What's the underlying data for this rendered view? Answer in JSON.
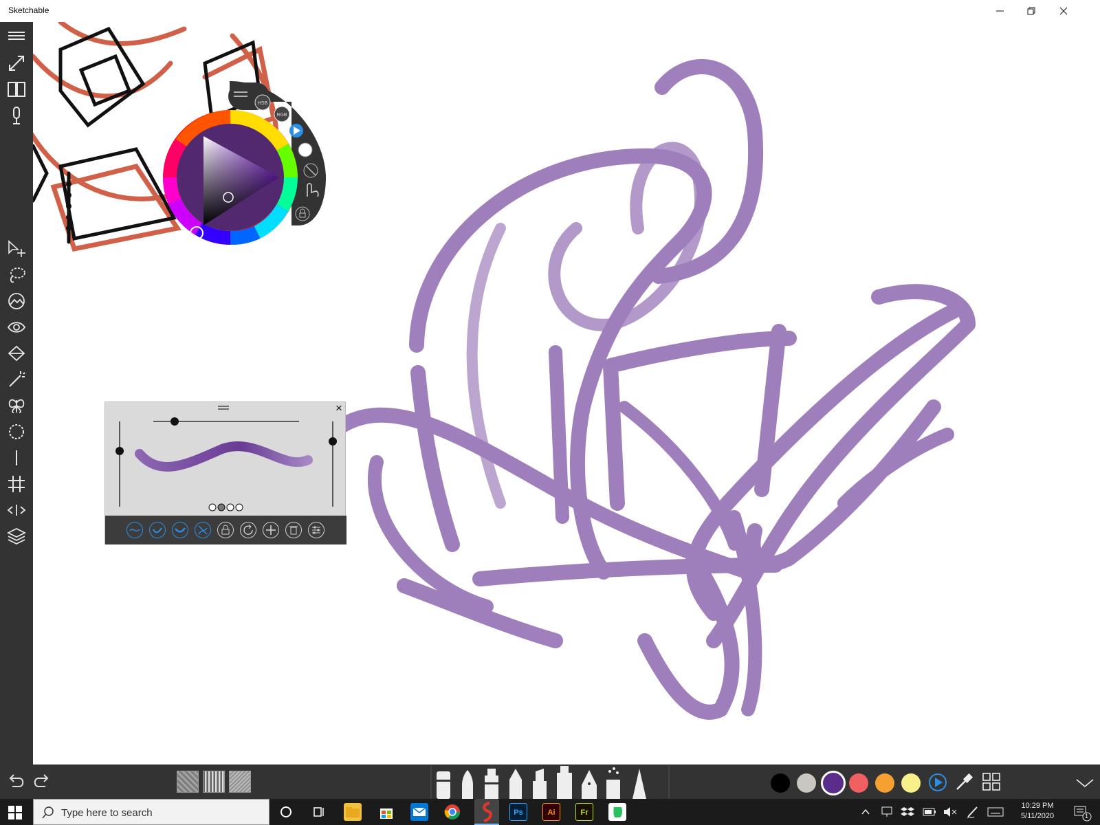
{
  "window": {
    "title": "Sketchable",
    "minimize_icon": "minimize-icon",
    "maximize_icon": "restore-icon",
    "close_icon": "close-icon"
  },
  "left_toolbar": {
    "items": [
      {
        "name": "menu-icon"
      },
      {
        "name": "fullscreen-icon"
      },
      {
        "name": "journal-icon"
      },
      {
        "name": "microphone-icon"
      },
      {
        "name": "select-move-icon"
      },
      {
        "name": "lasso-icon"
      },
      {
        "name": "image-icon"
      },
      {
        "name": "eye-icon"
      },
      {
        "name": "fill-bucket-icon"
      },
      {
        "name": "magic-wand-icon"
      },
      {
        "name": "symmetry-butterfly-icon"
      },
      {
        "name": "circle-guide-icon"
      },
      {
        "name": "line-guide-icon"
      },
      {
        "name": "grid-icon"
      },
      {
        "name": "perspective-icon"
      },
      {
        "name": "layers-icon"
      }
    ]
  },
  "color_picker": {
    "mode_hsb": "HSB",
    "mode_rgb": "RGB",
    "current_color": "#5b2d8a",
    "hue_ring": true
  },
  "brush_panel": {
    "close_label": "×",
    "preset_dots": 4,
    "active_dot": 2,
    "stroke_color": "#7a4fa3",
    "footer_buttons": [
      {
        "name": "smooth-stroke-icon",
        "active": true
      },
      {
        "name": "pressure-icon",
        "active": true
      },
      {
        "name": "taper-icon",
        "active": true
      },
      {
        "name": "jitter-icon",
        "active": true
      },
      {
        "name": "lock-icon",
        "active": false
      },
      {
        "name": "reset-icon",
        "active": false
      },
      {
        "name": "add-icon",
        "active": false
      },
      {
        "name": "delete-icon",
        "active": false
      },
      {
        "name": "settings-icon",
        "active": false
      }
    ]
  },
  "bottom_bar": {
    "undo_icon": "undo-icon",
    "redo_icon": "redo-icon",
    "textures": [
      "texture-1",
      "texture-2",
      "texture-3"
    ],
    "brushes": [
      "eraser",
      "brush",
      "marker",
      "pencil",
      "highlighter",
      "flat-marker",
      "fountain-pen",
      "airbrush",
      "smudge"
    ],
    "swatches": [
      "#000000",
      "#c8c8c0",
      "#5b2d8a",
      "#f06060",
      "#f5a030",
      "#f8f08a"
    ],
    "selected_swatch": 2,
    "play_icon": "play-icon",
    "eyedropper_icon": "eyedropper-icon",
    "palette_grid_icon": "grid-icon",
    "collapse_icon": "chevron-down-icon"
  },
  "taskbar": {
    "search_placeholder": "Type here to search",
    "apps": [
      {
        "name": "cortana",
        "label": ""
      },
      {
        "name": "task-view",
        "label": ""
      },
      {
        "name": "file-explorer",
        "label": ""
      },
      {
        "name": "store",
        "label": ""
      },
      {
        "name": "mail",
        "label": ""
      },
      {
        "name": "chrome",
        "label": ""
      },
      {
        "name": "sketchable",
        "label": ""
      },
      {
        "name": "photoshop",
        "label": "Ps"
      },
      {
        "name": "illustrator",
        "label": "Ai"
      },
      {
        "name": "fresco",
        "label": "Fr"
      },
      {
        "name": "evernote",
        "label": ""
      }
    ],
    "time": "10:29 PM",
    "date": "5/11/2020",
    "notification_count": "1"
  }
}
